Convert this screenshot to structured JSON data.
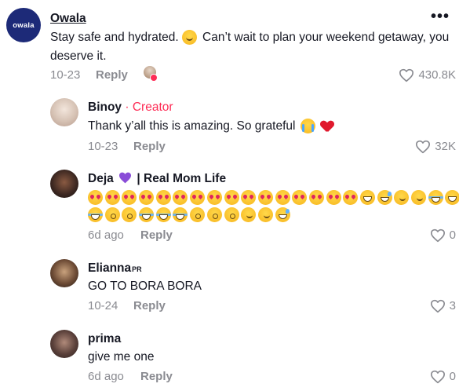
{
  "comments": [
    {
      "author": "Owala",
      "avatar_label": "owala",
      "text_before": "Stay safe and hydrated.",
      "text_after": " Can’t wait to plan your weekend getaway, you deserve it.",
      "date": "10-23",
      "reply_label": "Reply",
      "likes": "430.8K",
      "more_label": "•••"
    },
    {
      "author": "Binoy",
      "badge": "· Creator",
      "text": "Thank y’all this is amazing. So grateful",
      "date": "10-23",
      "reply_label": "Reply",
      "likes": "32K"
    },
    {
      "author": "Deja",
      "author_suffix": "| Real Mom Life",
      "date": "6d ago",
      "reply_label": "Reply",
      "likes": "0"
    },
    {
      "author": "Elianna",
      "author_tag": "PR",
      "text": "GO TO BORA BORA",
      "date": "10-24",
      "reply_label": "Reply",
      "likes": "3"
    },
    {
      "author": "prima",
      "text": "give me one",
      "date": "6d ago",
      "reply_label": "Reply",
      "likes": "0"
    }
  ],
  "colors": {
    "creator_badge": "#fe2c55",
    "meta_gray": "#8a8b91",
    "owala_brand": "#1d2a78",
    "purple_heart": "#8a4dd8"
  },
  "icons": {
    "like": "heart-outline-icon",
    "more": "more-dots-icon",
    "creator_liked": "creator-liked-avatar-icon"
  }
}
